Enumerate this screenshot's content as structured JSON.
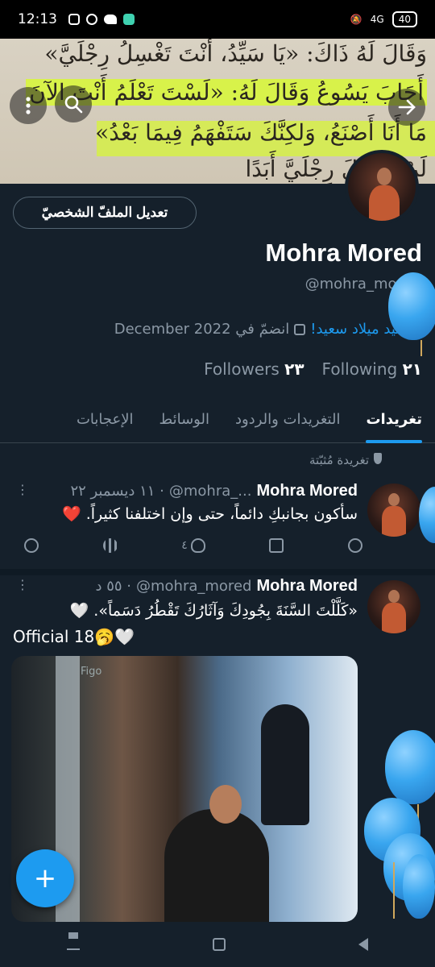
{
  "status_bar": {
    "time": "12:13",
    "network": "4G",
    "battery": "40"
  },
  "banner": {
    "line1": "وَقَالَ لَهُ ذَاكَ: «يَا سَيِّدُ، أَنْتَ تَغْسِلُ رِجْلَيَّ»",
    "line2": "أَجَابَ يَسُوعُ وَقَالَ لَهُ: «لَسْتَ تَعْلَمُ أَنْتَ الآنَ",
    "line3": "مَا أَنَا أَصْنَعُ، وَلكِنَّكَ سَتَفْهَمُ فِيمَا بَعْدُ»",
    "line4": "لَنْ تَغْسِلَ رِجْلَيَّ أَبَدًا"
  },
  "profile": {
    "edit_button": "تعديل الملفّ الشخصيّ",
    "name": "Mohra Mored",
    "handle": "@mohra_mored",
    "birthday": "عيد ميلاد سعيد!",
    "joined": "انضمّ في December 2022",
    "following_count": "٢١",
    "following_label": "Following",
    "followers_count": "٢٣",
    "followers_label": "Followers"
  },
  "tabs": [
    {
      "label": "تغريدات",
      "active": true
    },
    {
      "label": "التغريدات والردود",
      "active": false
    },
    {
      "label": "الوسائط",
      "active": false
    },
    {
      "label": "الإعجابات",
      "active": false
    }
  ],
  "pinned_label": "تغريدة مُثبّتة",
  "tweets": [
    {
      "name": "Mohra Mored",
      "handle": "@mohra_...",
      "time": "١١ ديسمبر ٢٢ ·",
      "text": "سأكون بجانبكِ دائماً، حتى وإن اختلفنا كثيراً. ❤️",
      "likes": "٤"
    },
    {
      "name": "Mohra Mored",
      "handle": "@mohra_mored",
      "time": "٥٥ د ·",
      "text": "«كَلَّلْتَ السَّنَةَ بِجُودِكَ وَآثَارُكَ تَقْطُرُ دَسَماً». 🤍",
      "text2": "Official 18🥱🤍",
      "image_caption": "Figo"
    }
  ],
  "fab_label": "+",
  "colors": {
    "background": "#15202b",
    "accent": "#1d9bf0",
    "muted": "#8b98a5"
  }
}
